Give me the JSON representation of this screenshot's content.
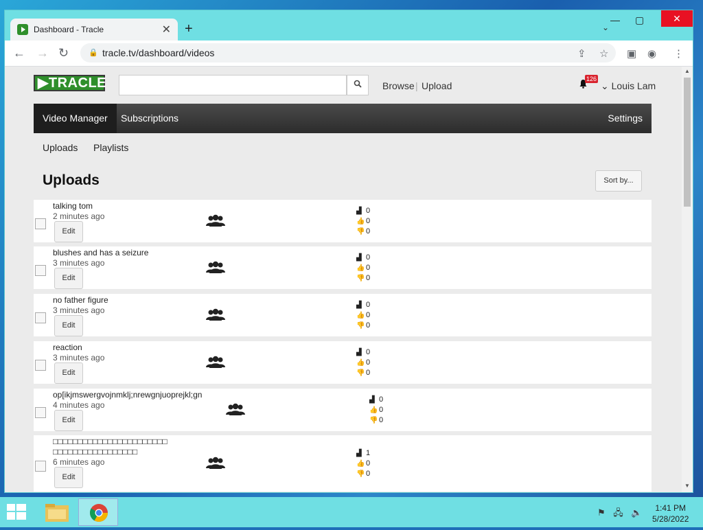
{
  "browser": {
    "tab_title": "Dashboard - Tracle",
    "url": "tracle.tv/dashboard/videos"
  },
  "site": {
    "logo": "TRACLE",
    "links": [
      "Browse",
      "Upload"
    ],
    "notification_count": "126",
    "user": "Louis Lam",
    "nav": {
      "video_manager": "Video Manager",
      "subscriptions": "Subscriptions",
      "settings": "Settings"
    },
    "subnav": {
      "uploads": "Uploads",
      "playlists": "Playlists"
    },
    "section_title": "Uploads",
    "sort_label": "Sort by..."
  },
  "videos": [
    {
      "title": "talking tom",
      "time": "2 minutes ago",
      "views": "0",
      "likes": "0",
      "dislikes": "0",
      "edit": "Edit"
    },
    {
      "title": "blushes and has a seizure",
      "time": "3 minutes ago",
      "views": "0",
      "likes": "0",
      "dislikes": "0",
      "edit": "Edit"
    },
    {
      "title": "no father figure",
      "time": "3 minutes ago",
      "views": "0",
      "likes": "0",
      "dislikes": "0",
      "edit": "Edit"
    },
    {
      "title": "reaction",
      "time": "3 minutes ago",
      "views": "0",
      "likes": "0",
      "dislikes": "0",
      "edit": "Edit"
    },
    {
      "title": "op[ikjmswergvojnmklj;nrewgnjuoprejkl;gn",
      "time": "4 minutes ago",
      "views": "0",
      "likes": "0",
      "dislikes": "0",
      "edit": "Edit"
    },
    {
      "title": "□□□□□□□□□□□□□□□□□□□□□□□",
      "title2": "□□□□□□□□□□□□□□□□□",
      "time": "6 minutes ago",
      "views": "1",
      "likes": "0",
      "dislikes": "0",
      "edit": "Edit"
    }
  ],
  "taskbar": {
    "time": "1:41 PM",
    "date": "5/28/2022"
  }
}
